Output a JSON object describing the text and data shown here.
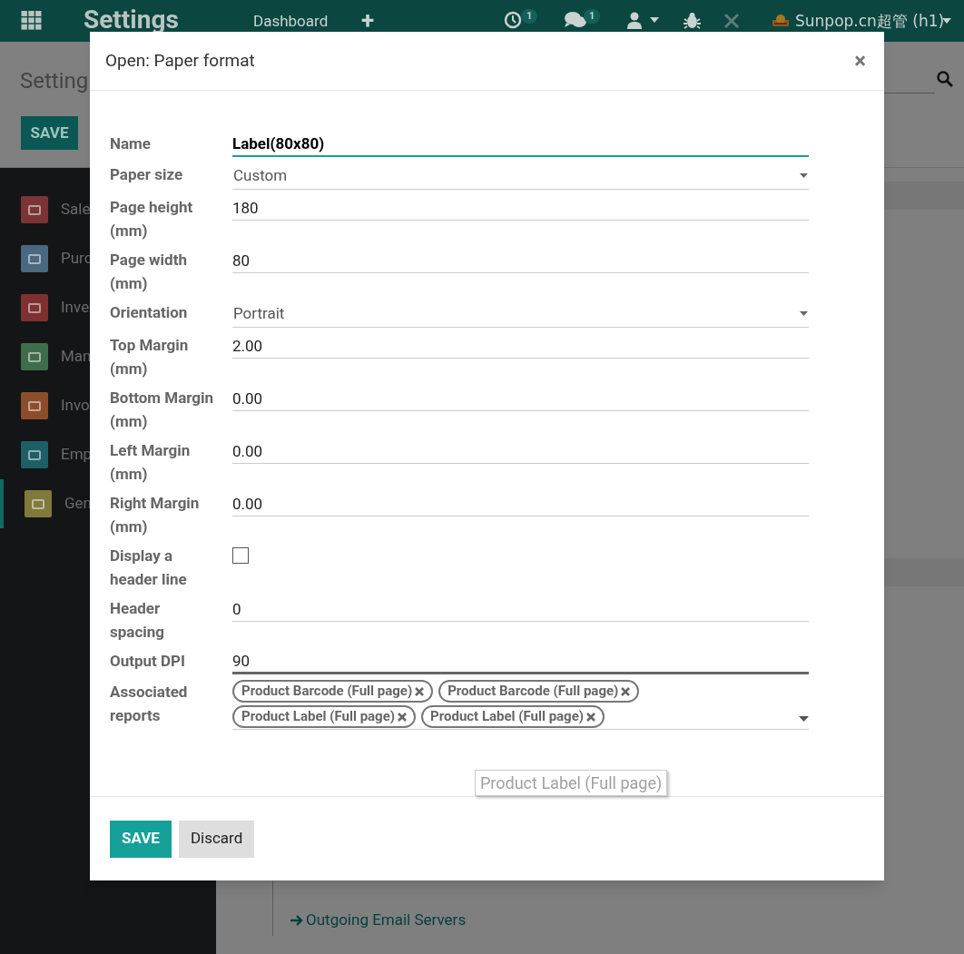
{
  "navbar": {
    "app_title": "Settings",
    "menu": [
      "Dashboard",
      "+"
    ],
    "activity_count": "1",
    "message_count": "1",
    "company": "Sunpop.cn超管 (h1)"
  },
  "control_panel": {
    "breadcrumb": "Setting",
    "save_label": "SAVE"
  },
  "sidebar": {
    "items": [
      {
        "label": "Sale",
        "color": "#7b3434",
        "selected": false
      },
      {
        "label": "Purc",
        "color": "#4a6880",
        "selected": false
      },
      {
        "label": "Inve",
        "color": "#7d3131",
        "selected": false
      },
      {
        "label": "Man",
        "color": "#3f6d4b",
        "selected": false
      },
      {
        "label": "Invo",
        "color": "#8c4d2c",
        "selected": false
      },
      {
        "label": "Emp",
        "color": "#1e5f66",
        "selected": false
      },
      {
        "label": "Gen",
        "color": "#7f7a3b",
        "selected": true
      }
    ]
  },
  "links": [
    "Outgoing Email Servers"
  ],
  "dialog": {
    "title": "Open: Paper format",
    "close": "×",
    "fields": [
      {
        "kind": "text",
        "label": "Name",
        "value": "Label(80x80)",
        "focused": true
      },
      {
        "kind": "select",
        "label": "Paper size",
        "value": "Custom"
      },
      {
        "kind": "text",
        "label": "Page height (mm)",
        "value": "180"
      },
      {
        "kind": "text",
        "label": "Page width (mm)",
        "value": "80"
      },
      {
        "kind": "select",
        "label": "Orientation",
        "value": "Portrait"
      },
      {
        "kind": "text",
        "label": "Top Margin (mm)",
        "value": "2.00"
      },
      {
        "kind": "text",
        "label": "Bottom Margin (mm)",
        "value": "0.00"
      },
      {
        "kind": "text",
        "label": "Left Margin (mm)",
        "value": "0.00"
      },
      {
        "kind": "text",
        "label": "Right Margin (mm)",
        "value": "0.00"
      },
      {
        "kind": "checkbox",
        "label": "Display a header line",
        "checked": false
      },
      {
        "kind": "text",
        "label": "Header spacing",
        "value": "0"
      },
      {
        "kind": "text",
        "label": "Output DPI",
        "value": "90",
        "hovered": true
      },
      {
        "kind": "tags",
        "label": "Associated reports",
        "tags": [
          "Product Barcode (Full page)",
          "Product Barcode (Full page)",
          "Product Label (Full page)",
          "Product Label (Full page)"
        ]
      }
    ],
    "tooltip": "Product Label (Full page)",
    "buttons": [
      {
        "kind": "primary",
        "label": "SAVE"
      },
      {
        "kind": "secondary",
        "label": "Discard"
      }
    ]
  }
}
